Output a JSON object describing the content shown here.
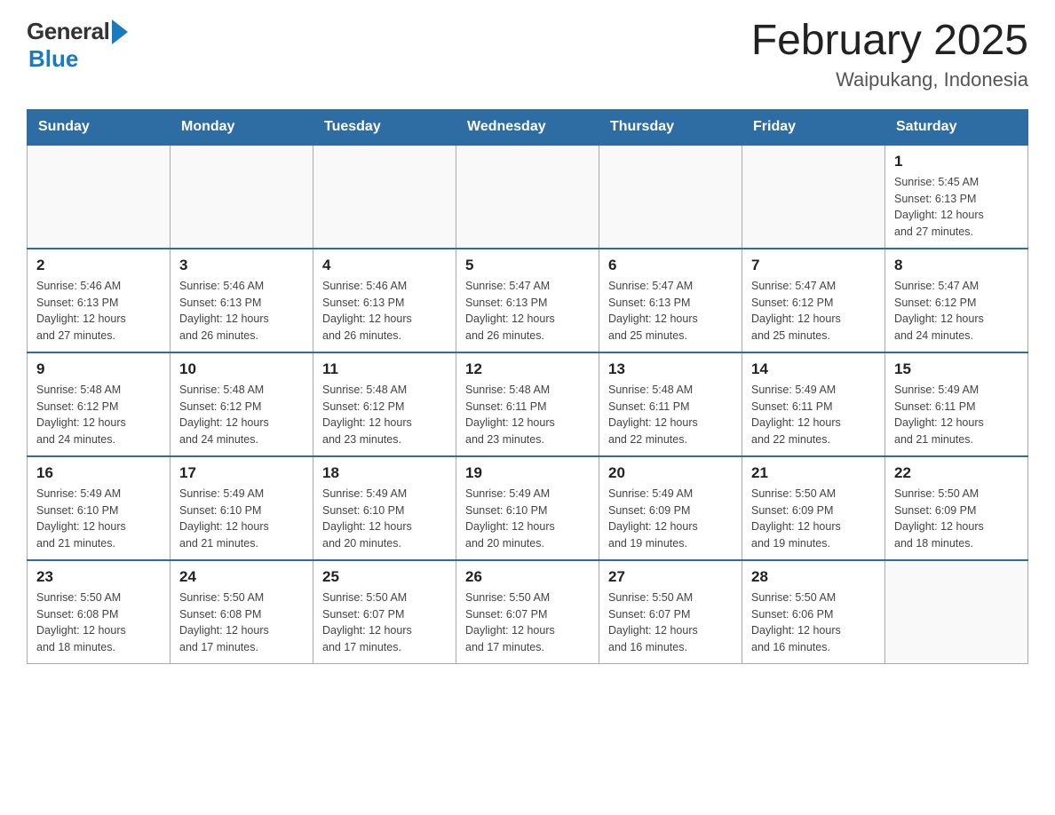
{
  "header": {
    "logo": {
      "general": "General",
      "blue": "Blue"
    },
    "title": "February 2025",
    "subtitle": "Waipukang, Indonesia"
  },
  "weekdays": [
    "Sunday",
    "Monday",
    "Tuesday",
    "Wednesday",
    "Thursday",
    "Friday",
    "Saturday"
  ],
  "weeks": [
    [
      {
        "day": "",
        "info": ""
      },
      {
        "day": "",
        "info": ""
      },
      {
        "day": "",
        "info": ""
      },
      {
        "day": "",
        "info": ""
      },
      {
        "day": "",
        "info": ""
      },
      {
        "day": "",
        "info": ""
      },
      {
        "day": "1",
        "info": "Sunrise: 5:45 AM\nSunset: 6:13 PM\nDaylight: 12 hours\nand 27 minutes."
      }
    ],
    [
      {
        "day": "2",
        "info": "Sunrise: 5:46 AM\nSunset: 6:13 PM\nDaylight: 12 hours\nand 27 minutes."
      },
      {
        "day": "3",
        "info": "Sunrise: 5:46 AM\nSunset: 6:13 PM\nDaylight: 12 hours\nand 26 minutes."
      },
      {
        "day": "4",
        "info": "Sunrise: 5:46 AM\nSunset: 6:13 PM\nDaylight: 12 hours\nand 26 minutes."
      },
      {
        "day": "5",
        "info": "Sunrise: 5:47 AM\nSunset: 6:13 PM\nDaylight: 12 hours\nand 26 minutes."
      },
      {
        "day": "6",
        "info": "Sunrise: 5:47 AM\nSunset: 6:13 PM\nDaylight: 12 hours\nand 25 minutes."
      },
      {
        "day": "7",
        "info": "Sunrise: 5:47 AM\nSunset: 6:12 PM\nDaylight: 12 hours\nand 25 minutes."
      },
      {
        "day": "8",
        "info": "Sunrise: 5:47 AM\nSunset: 6:12 PM\nDaylight: 12 hours\nand 24 minutes."
      }
    ],
    [
      {
        "day": "9",
        "info": "Sunrise: 5:48 AM\nSunset: 6:12 PM\nDaylight: 12 hours\nand 24 minutes."
      },
      {
        "day": "10",
        "info": "Sunrise: 5:48 AM\nSunset: 6:12 PM\nDaylight: 12 hours\nand 24 minutes."
      },
      {
        "day": "11",
        "info": "Sunrise: 5:48 AM\nSunset: 6:12 PM\nDaylight: 12 hours\nand 23 minutes."
      },
      {
        "day": "12",
        "info": "Sunrise: 5:48 AM\nSunset: 6:11 PM\nDaylight: 12 hours\nand 23 minutes."
      },
      {
        "day": "13",
        "info": "Sunrise: 5:48 AM\nSunset: 6:11 PM\nDaylight: 12 hours\nand 22 minutes."
      },
      {
        "day": "14",
        "info": "Sunrise: 5:49 AM\nSunset: 6:11 PM\nDaylight: 12 hours\nand 22 minutes."
      },
      {
        "day": "15",
        "info": "Sunrise: 5:49 AM\nSunset: 6:11 PM\nDaylight: 12 hours\nand 21 minutes."
      }
    ],
    [
      {
        "day": "16",
        "info": "Sunrise: 5:49 AM\nSunset: 6:10 PM\nDaylight: 12 hours\nand 21 minutes."
      },
      {
        "day": "17",
        "info": "Sunrise: 5:49 AM\nSunset: 6:10 PM\nDaylight: 12 hours\nand 21 minutes."
      },
      {
        "day": "18",
        "info": "Sunrise: 5:49 AM\nSunset: 6:10 PM\nDaylight: 12 hours\nand 20 minutes."
      },
      {
        "day": "19",
        "info": "Sunrise: 5:49 AM\nSunset: 6:10 PM\nDaylight: 12 hours\nand 20 minutes."
      },
      {
        "day": "20",
        "info": "Sunrise: 5:49 AM\nSunset: 6:09 PM\nDaylight: 12 hours\nand 19 minutes."
      },
      {
        "day": "21",
        "info": "Sunrise: 5:50 AM\nSunset: 6:09 PM\nDaylight: 12 hours\nand 19 minutes."
      },
      {
        "day": "22",
        "info": "Sunrise: 5:50 AM\nSunset: 6:09 PM\nDaylight: 12 hours\nand 18 minutes."
      }
    ],
    [
      {
        "day": "23",
        "info": "Sunrise: 5:50 AM\nSunset: 6:08 PM\nDaylight: 12 hours\nand 18 minutes."
      },
      {
        "day": "24",
        "info": "Sunrise: 5:50 AM\nSunset: 6:08 PM\nDaylight: 12 hours\nand 17 minutes."
      },
      {
        "day": "25",
        "info": "Sunrise: 5:50 AM\nSunset: 6:07 PM\nDaylight: 12 hours\nand 17 minutes."
      },
      {
        "day": "26",
        "info": "Sunrise: 5:50 AM\nSunset: 6:07 PM\nDaylight: 12 hours\nand 17 minutes."
      },
      {
        "day": "27",
        "info": "Sunrise: 5:50 AM\nSunset: 6:07 PM\nDaylight: 12 hours\nand 16 minutes."
      },
      {
        "day": "28",
        "info": "Sunrise: 5:50 AM\nSunset: 6:06 PM\nDaylight: 12 hours\nand 16 minutes."
      },
      {
        "day": "",
        "info": ""
      }
    ]
  ]
}
